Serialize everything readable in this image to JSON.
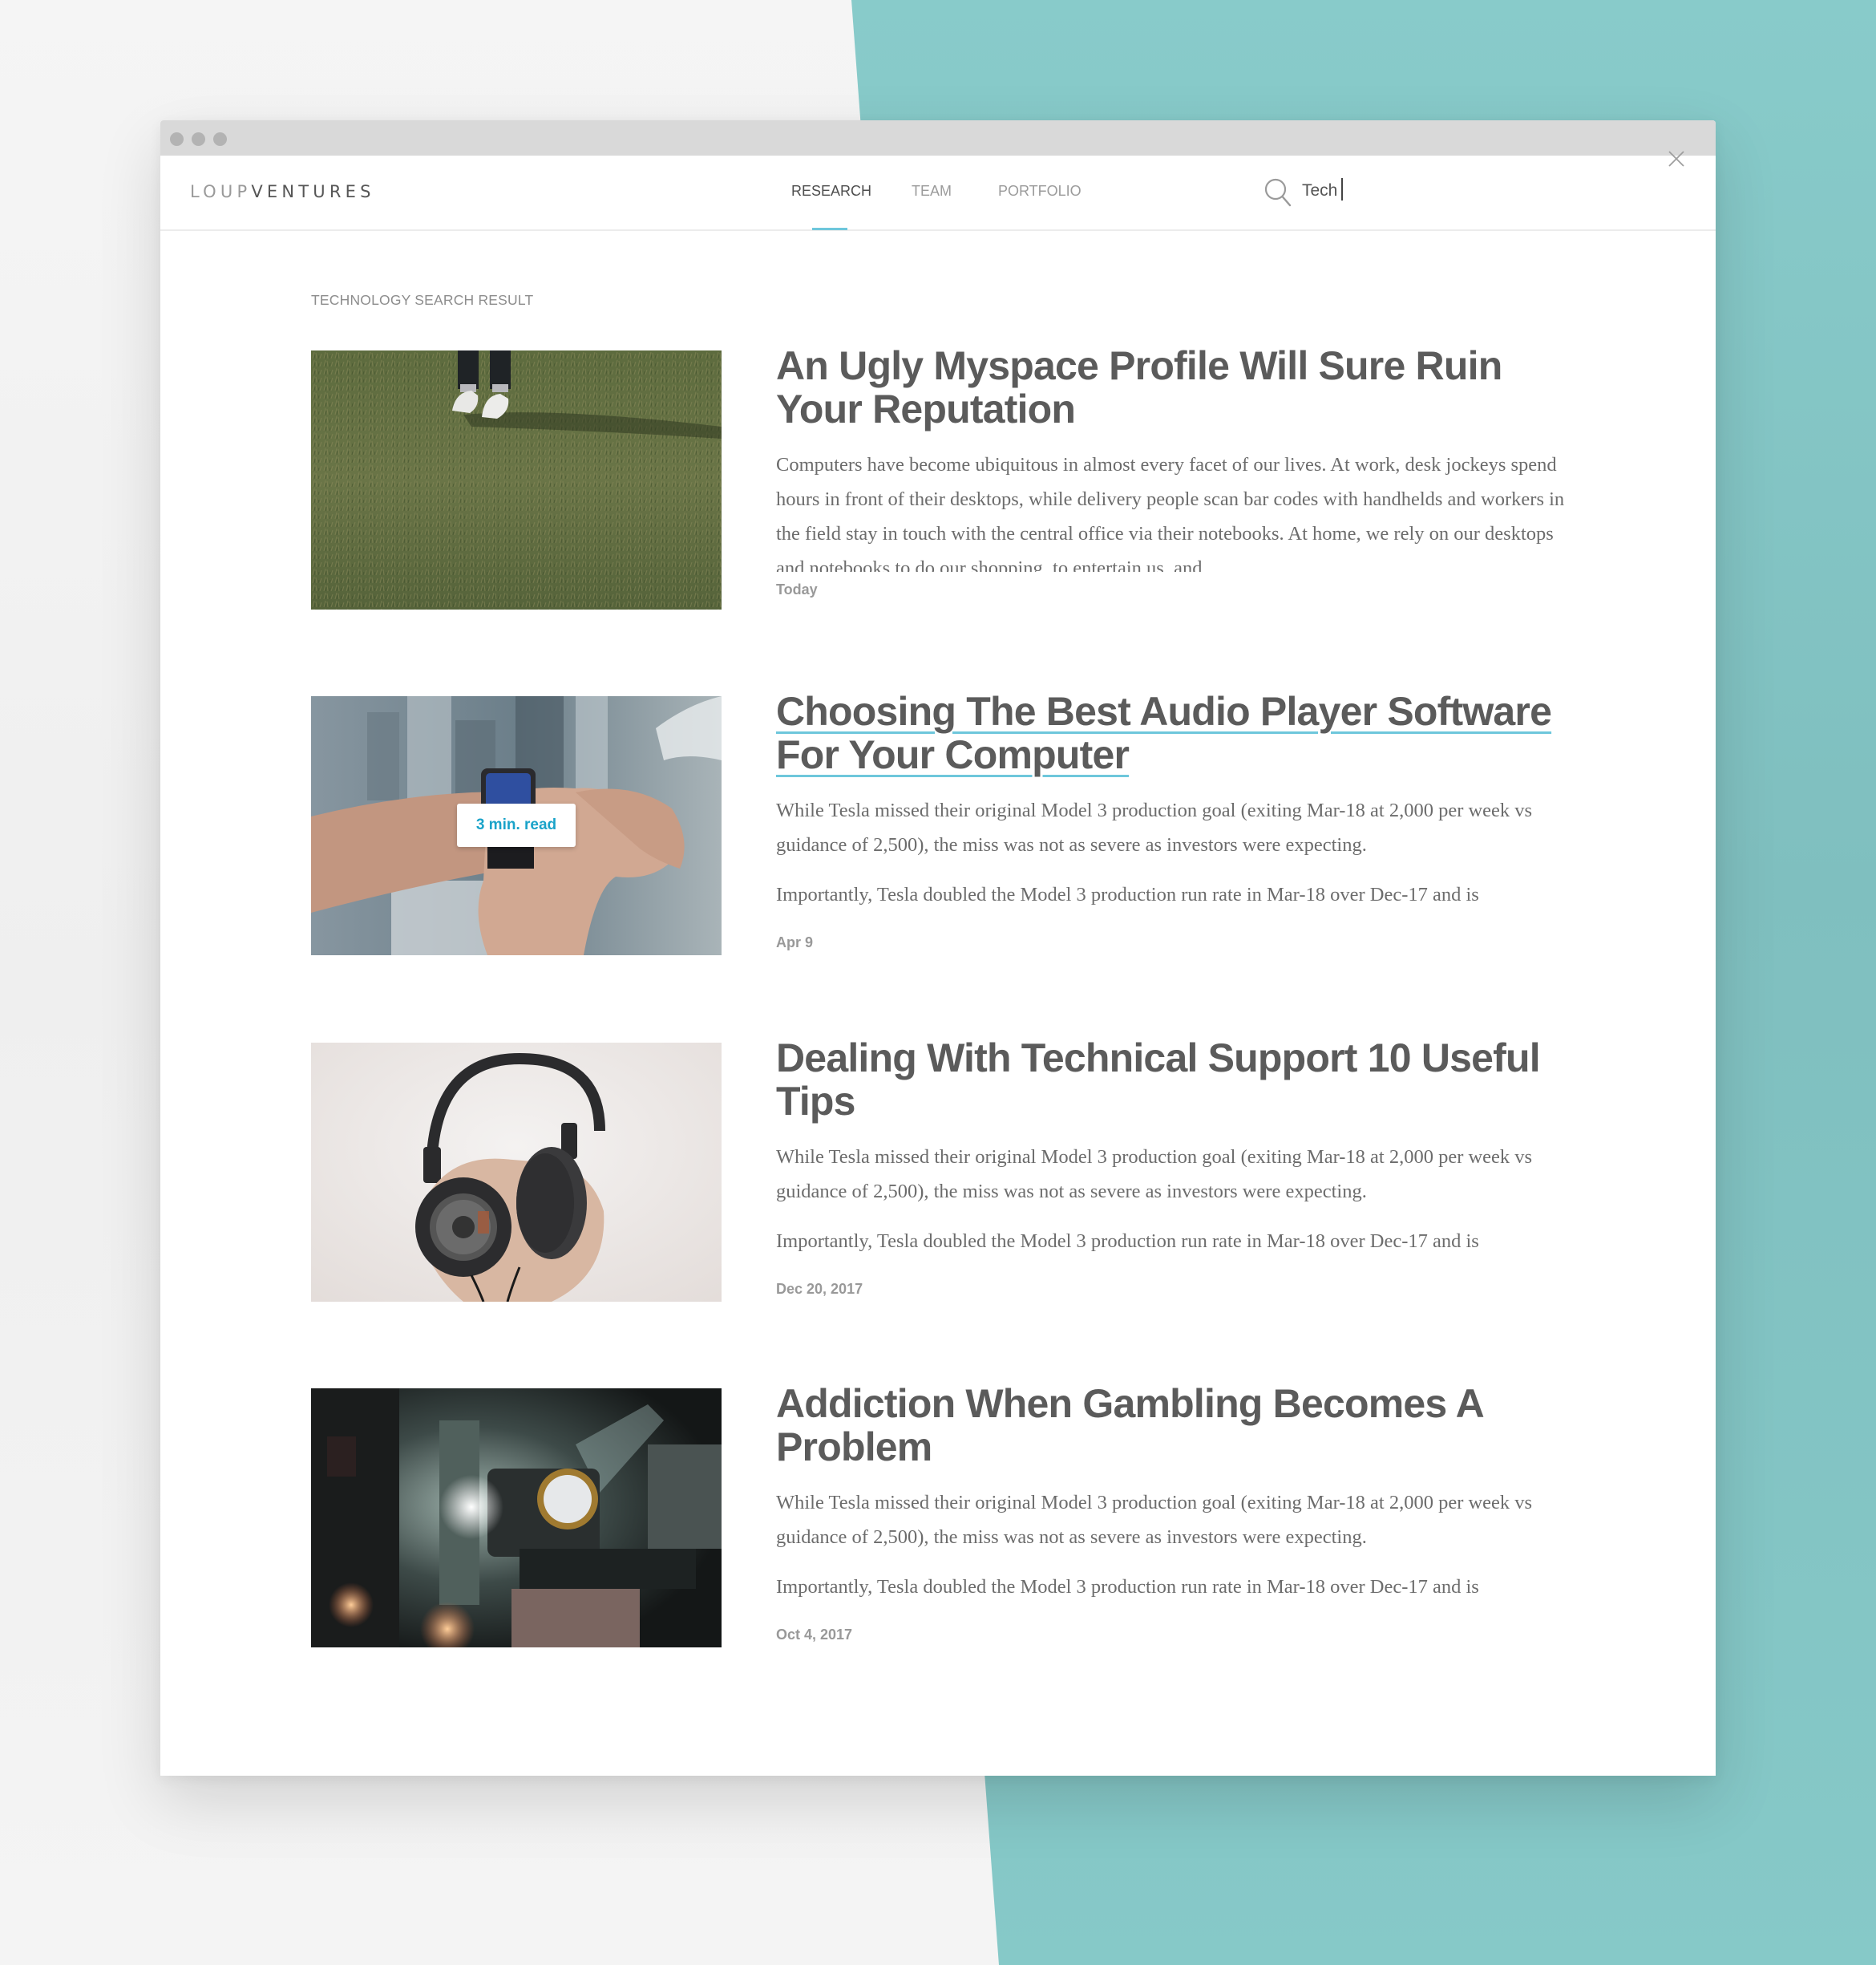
{
  "browser": {
    "window_controls": [
      "close",
      "minimize",
      "maximize"
    ]
  },
  "header": {
    "logo": {
      "part1": "LOUP",
      "part2": "VENTURES"
    },
    "nav": [
      {
        "label": "RESEARCH",
        "active": true
      },
      {
        "label": "TEAM",
        "active": false
      },
      {
        "label": "PORTFOLIO",
        "active": false
      }
    ],
    "search": {
      "value": "Tech",
      "placeholder": "",
      "icon": "search-icon"
    },
    "close_icon": "close-icon"
  },
  "colors": {
    "accent": "#6ec7dc",
    "badge_text": "#1aa3c9",
    "title": "#5b5b5b",
    "body": "#6c6c6c",
    "background_teal": "#84c7c6"
  },
  "main": {
    "section_label": "TECHNOLOGY SEARCH RESULT",
    "results": [
      {
        "title": "An Ugly Myspace Profile Will Sure Ruin Your Reputation",
        "image": "grass-with-sneakers",
        "paragraphs": [
          "Computers have become ubiquitous in almost every facet of our lives. At work, desk jockeys spend hours in front of their desktops, while delivery people scan bar codes with handhelds and workers in the field stay in touch with the central office via their notebooks. At home, we rely on our desktops and notebooks to do our shopping, to entertain us, and"
        ],
        "date": "Today"
      },
      {
        "title": "Choosing The Best Audio Player Software For Your Computer",
        "image": "smartwatch-on-wrist",
        "badge": "3 min. read",
        "hovered": true,
        "paragraphs": [
          "While Tesla missed their original Model 3 production goal (exiting Mar-18 at 2,000 per week vs guidance of 2,500), the miss was not as severe as investors were expecting.",
          "Importantly, Tesla doubled the Model 3 production run rate in Mar-18 over Dec-17 and is"
        ],
        "date": "Apr 9"
      },
      {
        "title": "Dealing With Technical Support 10 Useful Tips",
        "image": "headphones-in-hand",
        "paragraphs": [
          "While Tesla missed their original Model 3 production goal (exiting Mar-18 at 2,000 per week vs guidance of 2,500), the miss was not as severe as investors were expecting.",
          "Importantly, Tesla doubled the Model 3 production run rate in Mar-18 over Dec-17 and is"
        ],
        "date": "Dec 20, 2017"
      },
      {
        "title": "Addiction When Gambling Becomes A Problem",
        "image": "film-projector",
        "paragraphs": [
          "While Tesla missed their original Model 3 production goal (exiting Mar-18 at 2,000 per week vs guidance of 2,500), the miss was not as severe as investors were expecting.",
          "Importantly, Tesla doubled the Model 3 production run rate in Mar-18 over Dec-17 and is"
        ],
        "date": "Oct 4, 2017"
      }
    ]
  }
}
